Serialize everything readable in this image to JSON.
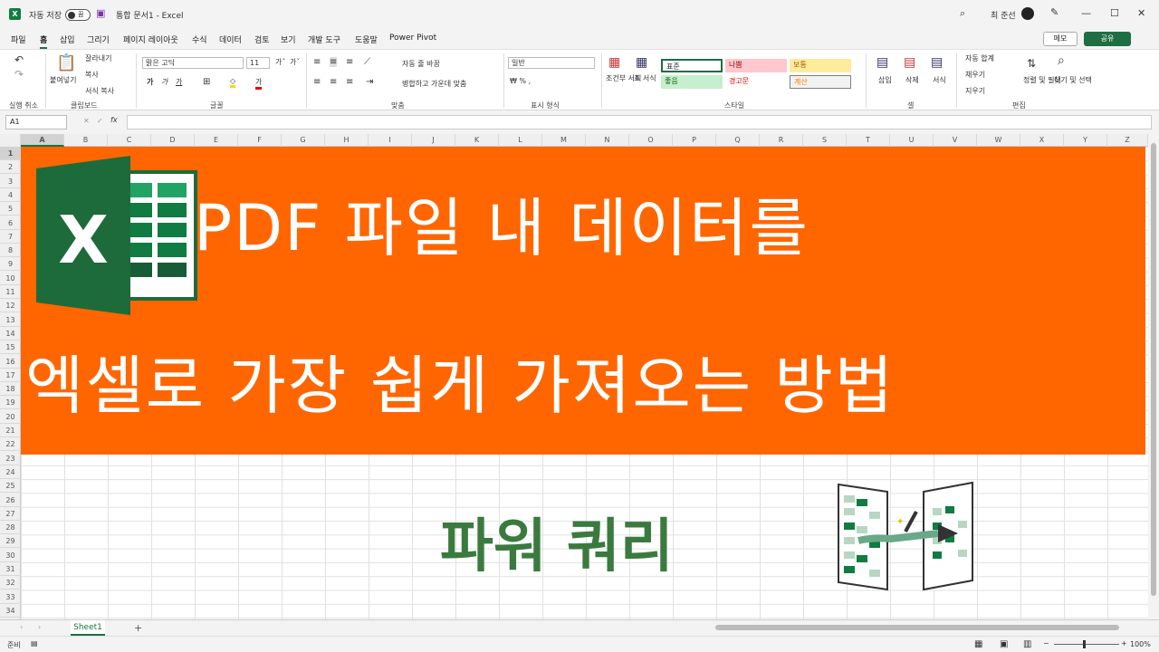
{
  "titlebar": {
    "autosave_label": "자동 저장",
    "autosave_state": "끔",
    "doc_title": "통합 문서1  -  Excel",
    "user": "최 준선",
    "controls": [
      "—",
      "☐",
      "✕"
    ]
  },
  "menu": {
    "items": [
      "파일",
      "홈",
      "삽입",
      "그리기",
      "페이지 레이아웃",
      "수식",
      "데이터",
      "검토",
      "보기",
      "개발 도구",
      "도움말",
      "Power Pivot"
    ],
    "active": "홈",
    "memo_label": "메모",
    "share_label": "공유"
  },
  "ribbon": {
    "groups": [
      "실행 취소",
      "클립보드",
      "글꼴",
      "맞춤",
      "표시 형식",
      "스타일",
      "셀",
      "편집"
    ],
    "paste_label": "붙여넣기",
    "cut_label": "잘라내기",
    "copy_label": "복사",
    "format_painter_label": "서식 복사",
    "font_name": "맑은 고딕",
    "font_size": "11",
    "wrap_text_label": "자동 줄 바꿈",
    "merge_label": "병합하고 가운데 맞춤",
    "number_format": "일반",
    "cond_format_label": "조건부 서식",
    "table_label": "표 서식",
    "styles": {
      "standard": "표준",
      "bad": "나쁨",
      "neutral": "보통",
      "good": "좋음",
      "warning": "경고문",
      "calc": "계산"
    },
    "insert_label": "삽입",
    "delete_label": "삭제",
    "format_label": "서식",
    "autosum_label": "자동 합계",
    "fill_label": "채우기",
    "clear_label": "지우기",
    "sort_filter_label": "정렬 및 필터",
    "find_select_label": "찾기 및 선택"
  },
  "formula_bar": {
    "name_box": "A1",
    "fx": "fx",
    "value": ""
  },
  "columns": [
    "A",
    "B",
    "C",
    "D",
    "E",
    "F",
    "G",
    "H",
    "I",
    "J",
    "K",
    "L",
    "M",
    "N",
    "O",
    "P",
    "Q",
    "R",
    "S",
    "T",
    "U",
    "V",
    "W",
    "X",
    "Y",
    "Z"
  ],
  "rows": [
    "1",
    "2",
    "3",
    "4",
    "5",
    "6",
    "7",
    "8",
    "9",
    "10",
    "11",
    "12",
    "13",
    "14",
    "15",
    "16",
    "17",
    "18",
    "19",
    "20",
    "21",
    "22",
    "23",
    "24",
    "25",
    "26",
    "27",
    "28",
    "29",
    "30",
    "31",
    "32",
    "33",
    "34"
  ],
  "banner": {
    "line1": "PDF 파일 내 데이터를",
    "line2": "엑셀로 가장 쉽게 가져오는 방법",
    "subtitle": "파워 쿼리",
    "banner_color": "#ff6600",
    "subtitle_color": "#3b7a3f"
  },
  "sheet_tabs": [
    "Sheet1"
  ],
  "status": {
    "ready": "준비",
    "zoom": "100%"
  }
}
